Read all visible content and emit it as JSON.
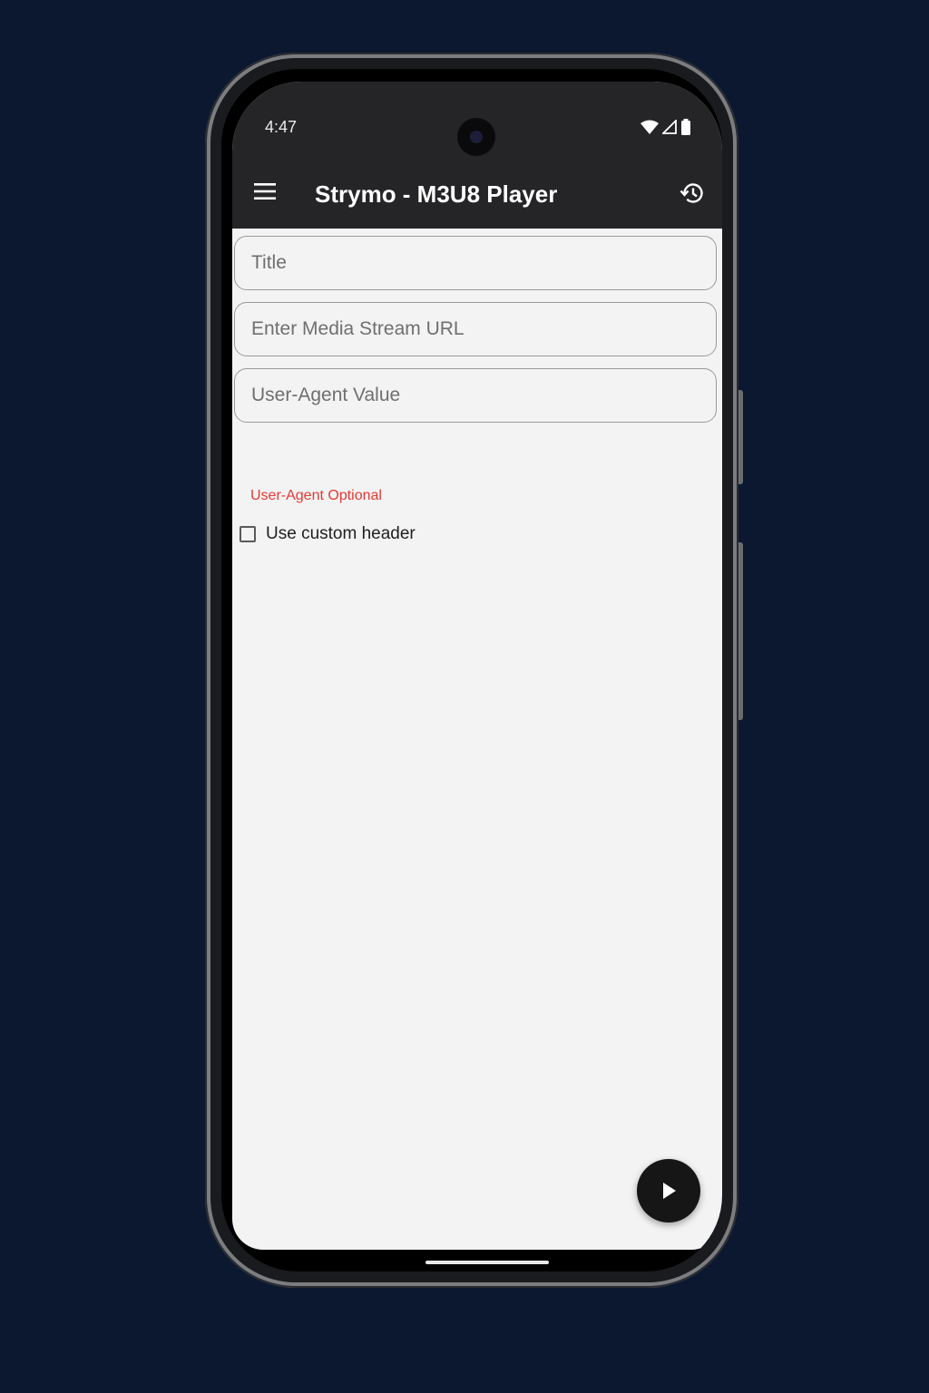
{
  "status_bar": {
    "time": "4:47",
    "icons": [
      "wifi-icon",
      "signal-icon",
      "battery-icon"
    ]
  },
  "app_bar": {
    "title": "Strymo - M3U8 Player",
    "menu_icon": "hamburger-menu-icon",
    "history_icon": "history-icon"
  },
  "form": {
    "title_placeholder": "Title",
    "url_placeholder": "Enter Media Stream URL",
    "user_agent_placeholder": "User-Agent Value",
    "user_agent_helper": "User-Agent Optional",
    "custom_header_label": "Use custom header",
    "custom_header_checked": false
  },
  "fab": {
    "icon": "play-icon"
  },
  "colors": {
    "page_background": "#0b1830",
    "app_bar": "#252528",
    "screen_background": "#f3f3f3",
    "helper_error": "#e53935",
    "fab": "#161616"
  }
}
